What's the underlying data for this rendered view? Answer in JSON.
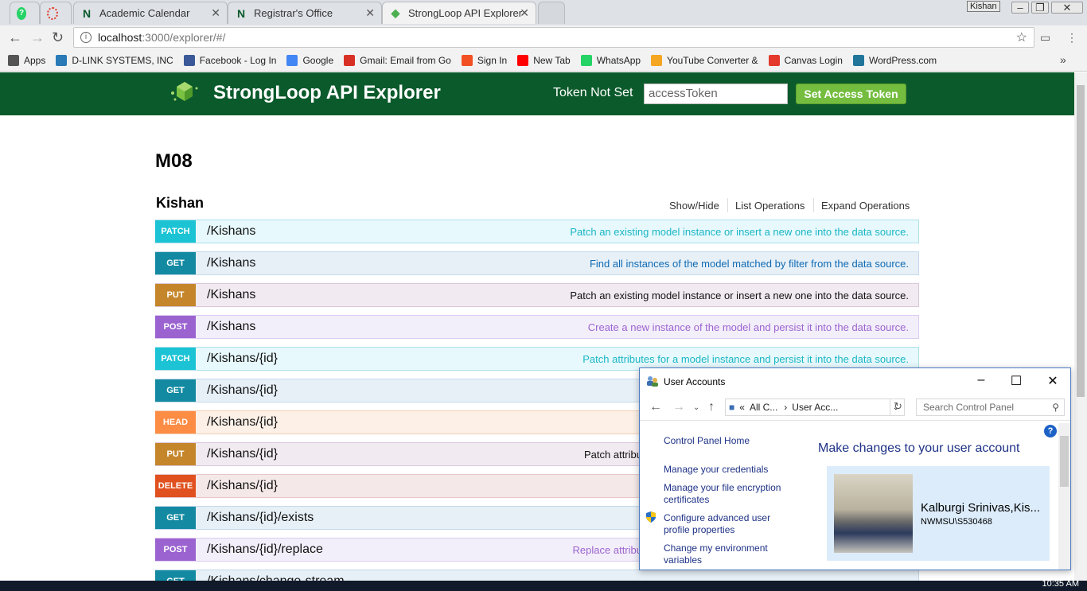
{
  "browser": {
    "tabs": [
      {
        "label": ""
      },
      {
        "label": ""
      },
      {
        "label": "Academic Calendar"
      },
      {
        "label": "Registrar's Office"
      },
      {
        "label": "StrongLoop API Explorer"
      }
    ],
    "profile": "Kishan",
    "url_host": "localhost",
    "url_rest": ":3000/explorer/#/",
    "bookmarks": [
      {
        "label": "Apps",
        "icon": "apps-grid-icon",
        "color": "#555555"
      },
      {
        "label": "D-LINK SYSTEMS, INC",
        "icon": "dlink-icon",
        "color": "#2a7ab8"
      },
      {
        "label": "Facebook - Log In",
        "icon": "facebook-icon",
        "color": "#3b5998"
      },
      {
        "label": "Google",
        "icon": "google-icon",
        "color": "#4285f4"
      },
      {
        "label": "Gmail: Email from Go",
        "icon": "gmail-icon",
        "color": "#d93025"
      },
      {
        "label": "Sign In",
        "icon": "microsoft-icon",
        "color": "#f25022"
      },
      {
        "label": "New Tab",
        "icon": "youtube-icon",
        "color": "#ff0000"
      },
      {
        "label": "WhatsApp",
        "icon": "whatsapp-icon",
        "color": "#25d366"
      },
      {
        "label": "YouTube Converter &",
        "icon": "converter-icon",
        "color": "#f5a623"
      },
      {
        "label": "Canvas Login",
        "icon": "canvas-icon",
        "color": "#e4392b"
      },
      {
        "label": "WordPress.com",
        "icon": "wordpress-icon",
        "color": "#21759b"
      }
    ]
  },
  "header": {
    "title": "StrongLoop API Explorer",
    "token_status": "Token Not Set",
    "token_placeholder": "accessToken",
    "token_button": "Set Access Token"
  },
  "main": {
    "model_title": "M08",
    "resource_name": "Kishan",
    "resource_actions": [
      "Show/Hide",
      "List Operations",
      "Expand Operations"
    ],
    "operations": [
      {
        "method": "PATCH",
        "path": "/Kishans",
        "summary": "Patch an existing model instance or insert a new one into the data source."
      },
      {
        "method": "GET",
        "path": "/Kishans",
        "summary": "Find all instances of the model matched by filter from the data source."
      },
      {
        "method": "PUT",
        "path": "/Kishans",
        "summary": "Patch an existing model instance or insert a new one into the data source."
      },
      {
        "method": "POST",
        "path": "/Kishans",
        "summary": "Create a new instance of the model and persist it into the data source."
      },
      {
        "method": "PATCH",
        "path": "/Kishans/{id}",
        "summary": "Patch attributes for a model instance and persist it into the data source."
      },
      {
        "method": "GET",
        "path": "/Kishans/{id}",
        "summary": ""
      },
      {
        "method": "HEAD",
        "path": "/Kishans/{id}",
        "summary": ""
      },
      {
        "method": "PUT",
        "path": "/Kishans/{id}",
        "summary": "Patch attribu"
      },
      {
        "method": "DELETE",
        "path": "/Kishans/{id}",
        "summary": ""
      },
      {
        "method": "GET",
        "path": "/Kishans/{id}/exists",
        "summary": ""
      },
      {
        "method": "POST",
        "path": "/Kishans/{id}/replace",
        "summary": "Replace attribu"
      },
      {
        "method": "GET",
        "path": "/Kishans/change-stream",
        "summary": ""
      }
    ]
  },
  "dialog": {
    "title": "User Accounts",
    "address_prefix": "«",
    "address_part1": "All C...",
    "address_sep": "›",
    "address_part2": "User Acc...",
    "search_placeholder": "Search Control Panel",
    "links": [
      "Control Panel Home",
      "Manage your credentials",
      "Manage your file encryption certificates",
      "Configure advanced user profile properties",
      "Change my environment variables"
    ],
    "heading": "Make changes to your user account",
    "user_name": "Kalburgi Srinivas,Kis...",
    "user_id": "NWMSU\\S530468",
    "help": "?"
  },
  "taskbar": {
    "clock": "10:35 AM"
  }
}
